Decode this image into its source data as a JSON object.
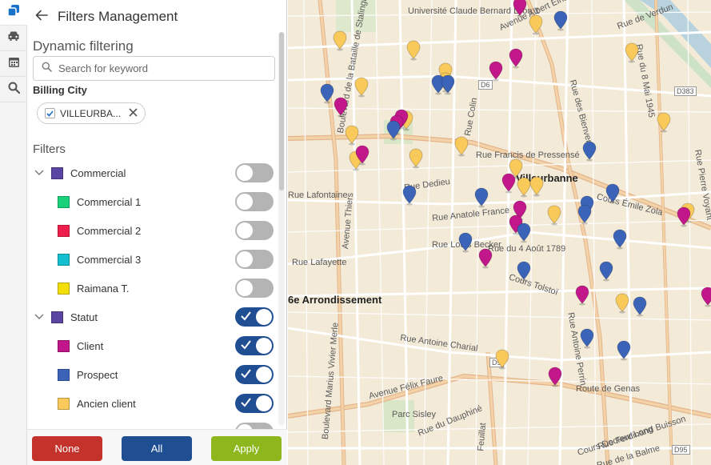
{
  "panel": {
    "title": "Filters Management",
    "dynamic_title": "Dynamic filtering",
    "search_placeholder": "Search for keyword",
    "billing_city_label": "Billing City",
    "selected_city": "VILLEURBA...",
    "filters_title": "Filters"
  },
  "groups": [
    {
      "label": "Commercial",
      "color": "#5a45a3",
      "enabled": false,
      "items": [
        {
          "label": "Commercial 1",
          "color": "#17d17b",
          "enabled": false
        },
        {
          "label": "Commercial 2",
          "color": "#ee1f4d",
          "enabled": false
        },
        {
          "label": "Commercial 3",
          "color": "#11bfcf",
          "enabled": false
        },
        {
          "label": "Raimana T.",
          "color": "#f3de0a",
          "enabled": false
        }
      ]
    },
    {
      "label": "Statut",
      "color": "#5a45a3",
      "enabled": true,
      "items": [
        {
          "label": "Client",
          "color": "#c2178a",
          "enabled": true
        },
        {
          "label": "Prospect",
          "color": "#3b64b8",
          "enabled": true
        },
        {
          "label": "Ancien client",
          "color": "#f9c95a",
          "enabled": true
        }
      ]
    }
  ],
  "footer": {
    "none_label": "None",
    "all_label": "All",
    "apply_label": "Apply",
    "none_color": "#c4322c",
    "all_color": "#1f4e93",
    "apply_color": "#8db71c"
  },
  "rail_icons": [
    "layers-icon",
    "car-icon",
    "calendar-icon",
    "search-icon"
  ],
  "map": {
    "labels": [
      "Université Claude Bernard Lyon 1",
      "Avenue Albert Einstein",
      "Boulevard de la Bataille de Stalingrad",
      "Rue des Bienvenus",
      "Rue Colin",
      "Rue Francis de Pressensé",
      "Villeurbanne",
      "Rue Dedieu",
      "Rue Anatole France",
      "Cours Émile Zola",
      "Rue Louis Becker",
      "Rue du 4 Août 1789",
      "Cours Tolstoï",
      "Rue Lafayette",
      "6e Arrondissement",
      "Rue Antoine Charial",
      "Avenue Félix Faure",
      "Rue du Dauphiné",
      "Route de Genas",
      "Cours Docteur Long",
      "Rue Ferdinand Buisson",
      "Rue de la Balme",
      "Avenue Thiers",
      "Boulevard Marius Vivier Merle",
      "Rue Antoine Perrin",
      "Rue du 8 Mai 1945",
      "Rue Pierre Voyant",
      "Feuillat",
      "Parc Sisley",
      "D383",
      "D6",
      "D5",
      "D95",
      "Rue Lafontaine",
      "Rue de Verdun"
    ],
    "pins": {
      "client_color": "#c2178a",
      "prospect_color": "#3b64b8",
      "ancien_color": "#f9c95a"
    }
  }
}
